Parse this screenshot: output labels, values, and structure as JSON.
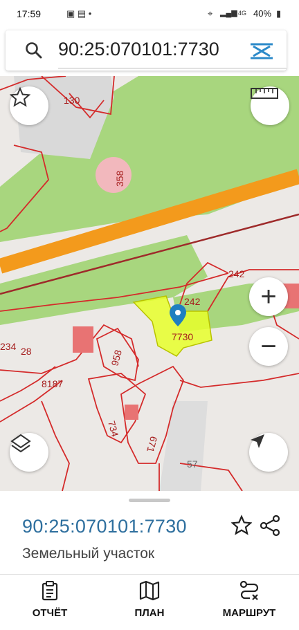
{
  "status_bar": {
    "time": "17:59",
    "network": "4G",
    "battery": "40%"
  },
  "search": {
    "query": "90:25:070101:7730",
    "close_icon": "close-icon"
  },
  "map": {
    "colors": {
      "road": "#f39a1c",
      "park": "#a8d67e",
      "parcel_line": "#d42b2b",
      "selected_fill": "#e8ff2a"
    },
    "labels": [
      "130",
      "358",
      "242",
      "242",
      "234",
      "28",
      "958",
      "8187",
      "734",
      "671",
      "57"
    ],
    "selected_label": "7730",
    "buttons": {
      "favorite": "star-icon",
      "measure": "ruler-icon",
      "zoom_in": "+",
      "zoom_out": "−",
      "layers": "layers-icon",
      "locate": "navigation-icon"
    }
  },
  "sheet": {
    "cadastral_number": "90:25:070101:7730",
    "object_type": "Земельный участок"
  },
  "tabs": [
    {
      "label": "ОТЧЁТ",
      "icon": "report-icon"
    },
    {
      "label": "ПЛАН",
      "icon": "map-icon"
    },
    {
      "label": "МАРШРУТ",
      "icon": "route-icon"
    }
  ]
}
